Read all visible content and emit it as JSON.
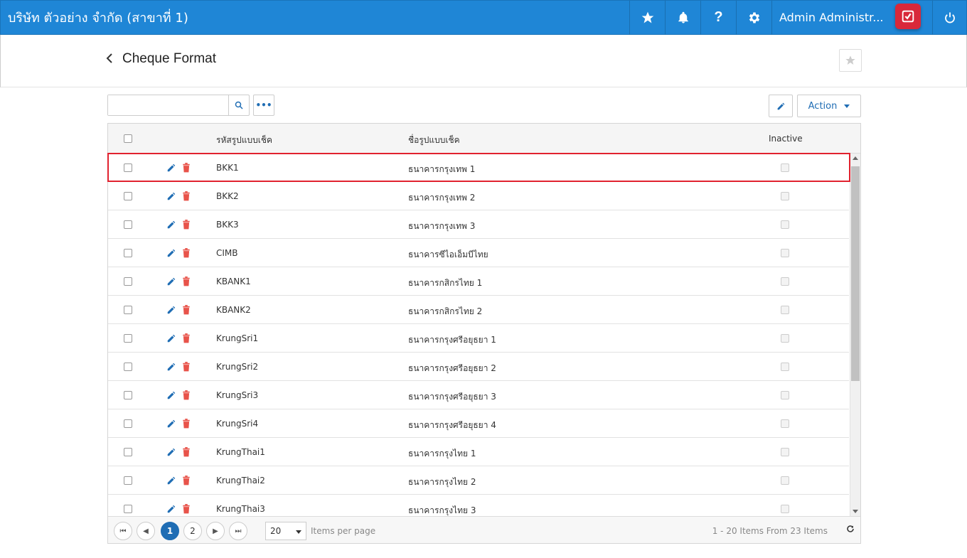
{
  "topbar": {
    "company": "บริษัท ตัวอย่าง จำกัด (สาขาที่ 1)",
    "user": "Admin Administr..."
  },
  "header": {
    "title": "Cheque Format"
  },
  "toolbar": {
    "search_placeholder": "",
    "action_label": "Action"
  },
  "grid": {
    "columns": {
      "code": "รหัสรูปแบบเช็ค",
      "name": "ชื่อรูปแบบเช็ค",
      "inactive": "Inactive"
    },
    "rows": [
      {
        "code": "BKK1",
        "name": "ธนาคารกรุงเทพ 1"
      },
      {
        "code": "BKK2",
        "name": "ธนาคารกรุงเทพ 2"
      },
      {
        "code": "BKK3",
        "name": "ธนาคารกรุงเทพ 3"
      },
      {
        "code": "CIMB",
        "name": "ธนาคารซีไอเอ็มบีไทย"
      },
      {
        "code": "KBANK1",
        "name": "ธนาคารกสิกรไทย 1"
      },
      {
        "code": "KBANK2",
        "name": "ธนาคารกสิกรไทย 2"
      },
      {
        "code": "KrungSri1",
        "name": "ธนาคารกรุงศรีอยุธยา 1"
      },
      {
        "code": "KrungSri2",
        "name": "ธนาคารกรุงศรีอยุธยา 2"
      },
      {
        "code": "KrungSri3",
        "name": "ธนาคารกรุงศรีอยุธยา 3"
      },
      {
        "code": "KrungSri4",
        "name": "ธนาคารกรุงศรีอยุธยา 4"
      },
      {
        "code": "KrungThai1",
        "name": "ธนาคารกรุงไทย 1"
      },
      {
        "code": "KrungThai2",
        "name": "ธนาคารกรุงไทย 2"
      },
      {
        "code": "KrungThai3",
        "name": "ธนาคารกรุงไทย 3"
      }
    ]
  },
  "pager": {
    "pages": [
      "1",
      "2"
    ],
    "current": "1",
    "page_size": "20",
    "per_page_label": "Items per page",
    "info": "1 - 20 Items From 23 Items"
  },
  "colors": {
    "topbar": "#1f86d6",
    "accent": "#1f6db4",
    "delete": "#e8534a",
    "highlight": "#e1222f"
  }
}
